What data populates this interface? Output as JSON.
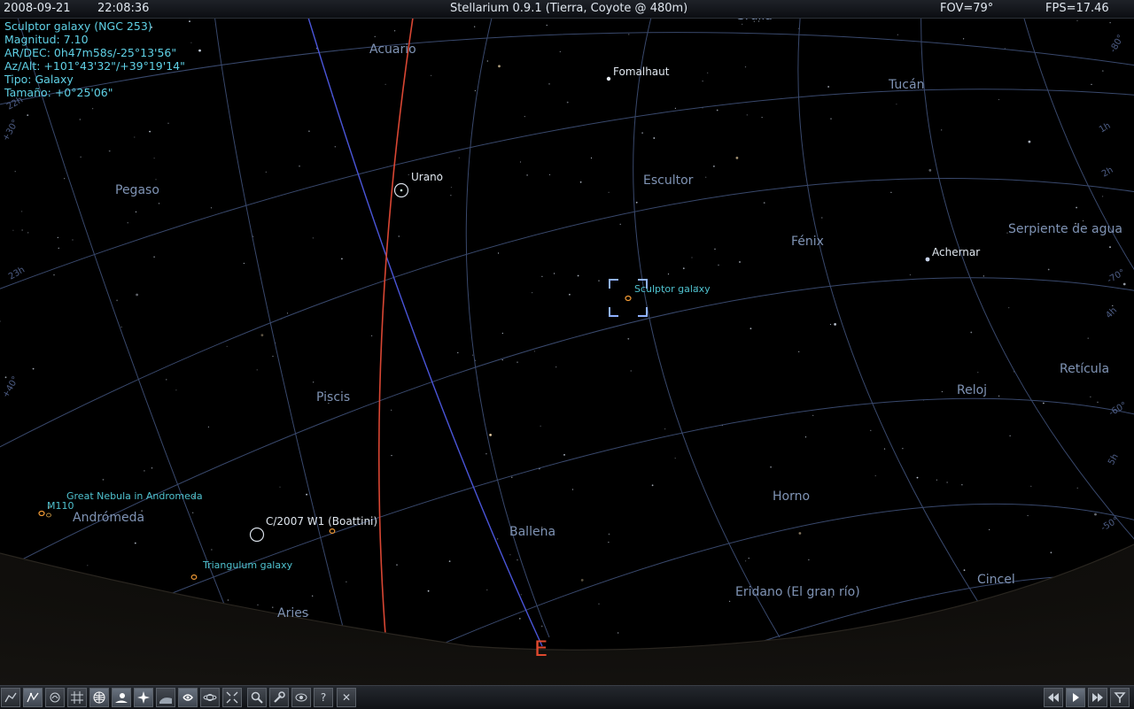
{
  "window": {
    "date": "2008-09-21",
    "time": "22:08:36",
    "title": "Stellarium 0.9.1 (Tierra, Coyote @ 480m)",
    "fov": "FOV=79°",
    "fps": "FPS=17.46"
  },
  "selected_object": {
    "name": "Sculptor galaxy (NGC 253)",
    "magnitude": "Magnitud: 7.10",
    "ra_dec": "AR/DEC:  0h47m58s/-25°13'56\"",
    "az_alt": "Az/Alt: +101°43'32\"/+39°19'14\"",
    "type": "Tipo: Galaxy",
    "size": "Tamaño: +0°25'06\""
  },
  "constellations": [
    "Grulla",
    "Acuario",
    "Tucán",
    "Pegaso",
    "Escultor",
    "Fénix",
    "Serpiente de agua",
    "Piscis",
    "Reloj",
    "Retícula",
    "Andrómeda",
    "Ballena",
    "Horno",
    "Aries",
    "Eridano (El gran río)",
    "Cincel"
  ],
  "stars": [
    "Fomalhaut",
    "Achernar"
  ],
  "planets": [
    "Urano"
  ],
  "deep_sky": [
    "Sculptor galaxy",
    "Great Nebula in Andromeda",
    "M110",
    "Triangulum galaxy"
  ],
  "comets": [
    "C/2007 W1 (Boattini)"
  ],
  "grid_labels": [
    "22h",
    "23h",
    "1h",
    "2h",
    "4h",
    "5h",
    "+30°",
    "+40°",
    "-50°",
    "-60°",
    "-70°",
    "-80°"
  ],
  "cardinal": "E",
  "colors": {
    "constellation_label": "#7f93b4",
    "dso_label": "#4fc2cf",
    "star_label": "#dfe6ee",
    "grid": "#3d4d73",
    "meridian": "#4a55d8",
    "ecliptic": "#d84633",
    "cardinal": "#e0492e",
    "selection": "#8fb1ff",
    "info_text": "#5fd1e6"
  },
  "toolbar": {
    "left_icons": [
      "constellation-lines-icon",
      "constellation-names-icon",
      "constellation-art-icon",
      "equatorial-grid-icon",
      "azimuth-grid-icon",
      "ground-icon",
      "cardinal-points-icon",
      "atmosphere-icon",
      "nebulas-icon",
      "planets-icon",
      "equatorial-mount-icon",
      "center-object-icon",
      "search-icon",
      "configuration-icon",
      "night-mode-icon",
      "help-icon",
      "quit-icon"
    ],
    "help_label": "?",
    "quit_label": "✕",
    "time_icons": [
      "rewind-icon",
      "play-icon",
      "fast-forward-icon",
      "real-time-icon"
    ]
  }
}
